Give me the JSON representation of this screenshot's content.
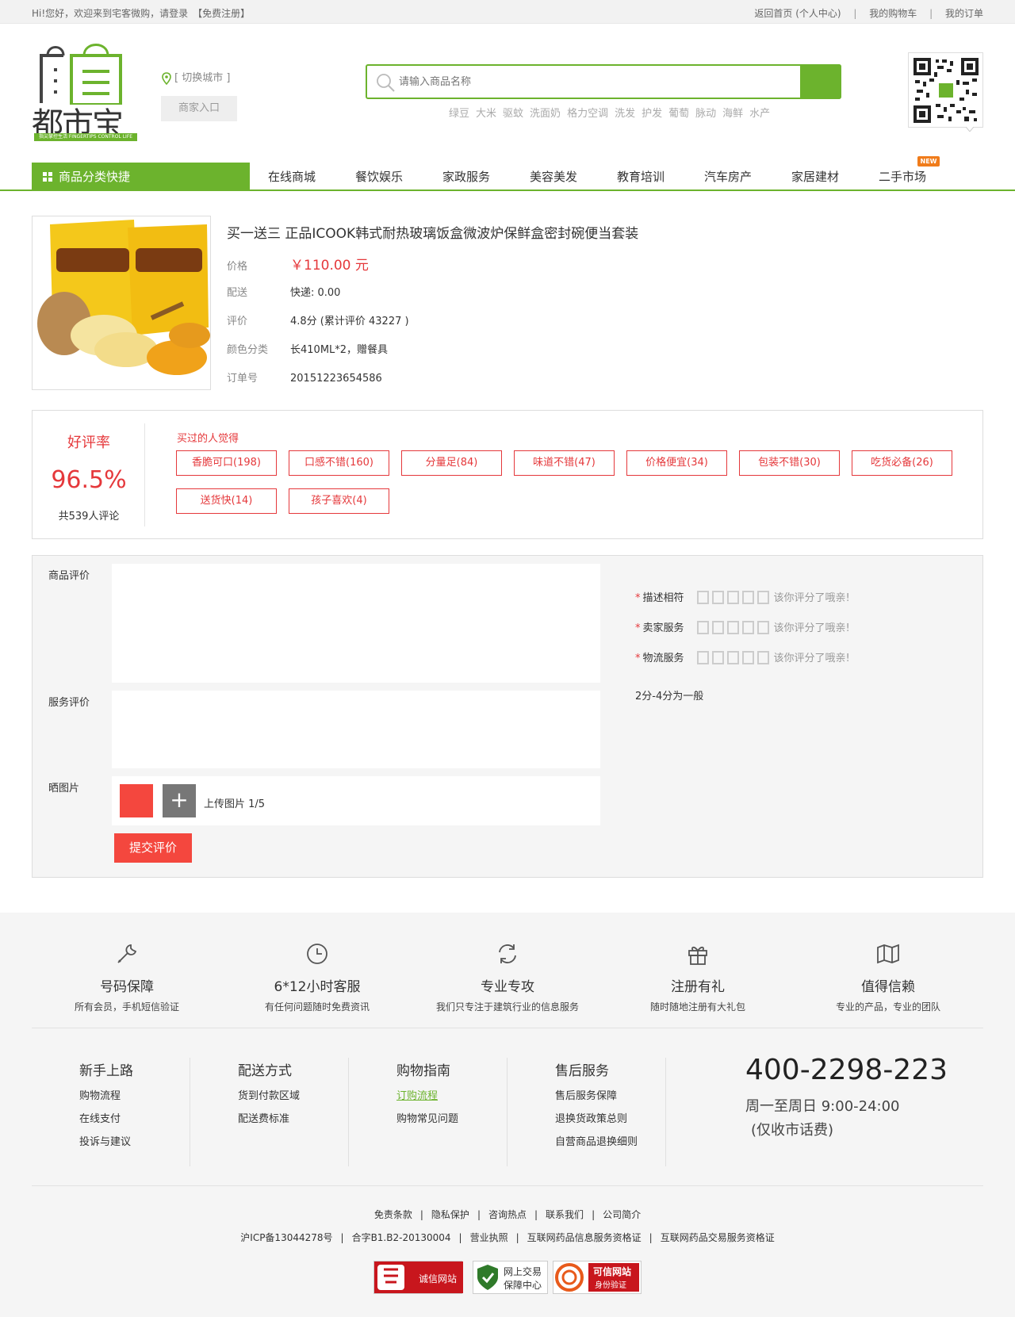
{
  "topbar": {
    "greeting": "Hi!您好，欢迎来到宅客微购，请登录",
    "register": "【免费注册】",
    "links": [
      "返回首页 (个人中心)",
      "|",
      "我的购物车",
      "|",
      "我的订单"
    ]
  },
  "header": {
    "logo_text": "都市宝",
    "logo_tagline": "指尖掌控生活 FINGERTIPS CONTROL LIFE",
    "city": "[ 切换城市 ]",
    "merchant": "商家入口",
    "search_placeholder": "请输入商品名称",
    "hot_words": [
      "绿豆",
      "大米",
      "驱蚊",
      "洗面奶",
      "格力空调",
      "洗发",
      "护发",
      "葡萄",
      "脉动",
      "海鲜",
      "水产"
    ]
  },
  "nav": {
    "category": "商品分类快捷",
    "items": [
      "在线商城",
      "餐饮娱乐",
      "家政服务",
      "美容美发",
      "教育培训",
      "汽车房产",
      "家居建材",
      "二手市场"
    ],
    "new_badge": "NEW"
  },
  "product": {
    "title": "买一送三 正品ICOOK韩式耐热玻璃饭盒微波炉保鲜盒密封碗便当套装",
    "rows": [
      {
        "k": "价格",
        "v": "￥110.00 元"
      },
      {
        "k": "配送",
        "v": "快递: 0.00"
      },
      {
        "k": "评价",
        "v": "4.8分 (累计评价 43227 )"
      },
      {
        "k": "颜色分类",
        "v": "长410ML*2，赠餐具"
      },
      {
        "k": "订单号",
        "v": "20151223654586"
      }
    ]
  },
  "rating": {
    "title": "好评率",
    "value": "96.5%",
    "count": "共539人评论",
    "tags_title": "买过的人觉得",
    "tags": [
      "香脆可口(198)",
      "口感不错(160)",
      "分量足(84)",
      "味道不错(47)",
      "价格便宜(34)",
      "包装不错(30)",
      "吃货必备(26)",
      "送货快(14)",
      "孩子喜欢(4)"
    ]
  },
  "form": {
    "goods_label": "商品评价",
    "service_label": "服务评价",
    "photo_label": "晒图片",
    "upload_plus": "+",
    "upload_text": "上传图片 1/5",
    "submit": "提交评价",
    "star_rows": [
      {
        "label": "描述相符",
        "tip": "该你评分了哦亲!"
      },
      {
        "label": "卖家服务",
        "tip": "该你评分了哦亲!"
      },
      {
        "label": "物流服务",
        "tip": "该你评分了哦亲!"
      }
    ],
    "required": "*",
    "scale_note": "2分-4分为一般"
  },
  "footer": {
    "features": [
      {
        "icon": "wrench-icon",
        "title": "号码保障",
        "desc": "所有会员，手机短信验证"
      },
      {
        "icon": "clock-icon",
        "title": "6*12小时客服",
        "desc": "有任何问题随时免费资讯"
      },
      {
        "icon": "refresh-icon",
        "title": "专业专攻",
        "desc": "我们只专注于建筑行业的信息服务"
      },
      {
        "icon": "gift-icon",
        "title": "注册有礼",
        "desc": "随时随地注册有大礼包"
      },
      {
        "icon": "map-icon",
        "title": "值得信赖",
        "desc": "专业的产品，专业的团队"
      }
    ],
    "columns": [
      {
        "title": "新手上路",
        "items": [
          "购物流程",
          "在线支付",
          "投诉与建议"
        ]
      },
      {
        "title": "配送方式",
        "items": [
          "货到付款区域",
          "配送费标准"
        ]
      },
      {
        "title": "购物指南",
        "items": [
          "订购流程",
          "购物常见问题"
        ]
      },
      {
        "title": "售后服务",
        "items": [
          "售后服务保障",
          "退换货政策总则",
          "自营商品退换细则"
        ]
      }
    ],
    "phone": "400-2298-223",
    "hours": "周一至周日 9:00-24:00",
    "note": "(仅收市话费)",
    "links1": [
      "免责条款",
      "|",
      "隐私保护",
      "|",
      "咨询热点",
      "|",
      "联系我们",
      "|",
      "公司简介"
    ],
    "links2": [
      "沪ICP备13044278号",
      "|",
      "合字B1.B2-20130004",
      "|",
      "营业执照",
      "|",
      "互联网药品信息服务资格证",
      "|",
      "互联网药品交易服务资格证"
    ],
    "badges": [
      "诚信网站",
      "网上交易",
      "保障中心",
      "可信网站",
      "身份验证"
    ]
  },
  "colors": {
    "green": "#6cb32d",
    "red": "#e5383b",
    "orange": "#f07c1b"
  }
}
